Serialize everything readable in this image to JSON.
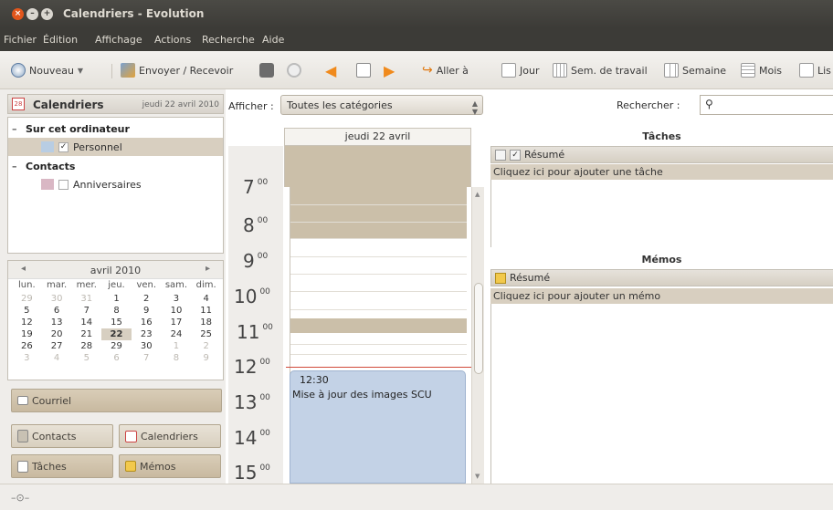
{
  "window": {
    "title": "Calendriers - Evolution"
  },
  "menubar": [
    "Fichier",
    "Édition",
    "Affichage",
    "Actions",
    "Recherche",
    "Aide"
  ],
  "toolbar": {
    "nouveau": "Nouveau",
    "envoyer": "Envoyer / Recevoir",
    "aller": "Aller à",
    "jour": "Jour",
    "sem_travail": "Sem. de travail",
    "semaine": "Semaine",
    "mois": "Mois",
    "liste": "Lis"
  },
  "sidebar": {
    "header_title": "Calendriers",
    "header_date": "jeudi 22 avril 2010",
    "groups": [
      {
        "label": "Sur cet ordinateur",
        "items": [
          {
            "label": "Personnel",
            "checked": true,
            "color": "#b8cde3"
          }
        ]
      },
      {
        "label": "Contacts",
        "items": [
          {
            "label": "Anniversaires",
            "checked": false,
            "color": "#d9b7c4"
          }
        ]
      }
    ]
  },
  "minical": {
    "prev": "◂",
    "next": "▸",
    "month": "avril 2010",
    "days": [
      "lun.",
      "mar.",
      "mer.",
      "jeu.",
      "ven.",
      "sam.",
      "dim."
    ],
    "weeks": [
      [
        "29",
        "30",
        "31",
        "1",
        "2",
        "3",
        "4"
      ],
      [
        "5",
        "6",
        "7",
        "8",
        "9",
        "10",
        "11"
      ],
      [
        "12",
        "13",
        "14",
        "15",
        "16",
        "17",
        "18"
      ],
      [
        "19",
        "20",
        "21",
        "22",
        "23",
        "24",
        "25"
      ],
      [
        "26",
        "27",
        "28",
        "29",
        "30",
        "1",
        "2"
      ],
      [
        "3",
        "4",
        "5",
        "6",
        "7",
        "8",
        "9"
      ]
    ],
    "today": "22"
  },
  "switcher": {
    "courriel": "Courriel",
    "contacts": "Contacts",
    "calendriers": "Calendriers",
    "taches": "Tâches",
    "memos": "Mémos"
  },
  "dayview": {
    "afficher_label": "Afficher :",
    "category": "Toutes les catégories",
    "day_header": "jeudi 22 avril",
    "hours": [
      {
        "h": "7",
        "m": "00"
      },
      {
        "h": "8",
        "m": "00"
      },
      {
        "h": "9",
        "m": "00"
      },
      {
        "h": "10",
        "m": "00"
      },
      {
        "h": "11",
        "m": "00"
      },
      {
        "h": "12",
        "m": "00"
      },
      {
        "h": "13",
        "m": "00"
      },
      {
        "h": "14",
        "m": "00"
      },
      {
        "h": "15",
        "m": "00"
      }
    ],
    "event": {
      "time": "12:30",
      "title": "Mise à jour des images SCU"
    }
  },
  "search": {
    "label": "Rechercher :",
    "value": ""
  },
  "tasks": {
    "title": "Tâches",
    "column": "Résumé",
    "add_hint": "Cliquez ici pour ajouter une tâche"
  },
  "memos": {
    "title": "Mémos",
    "column": "Résumé",
    "add_hint": "Cliquez ici pour ajouter un mémo"
  },
  "colors": {
    "accent": "#cbbfa9",
    "event": "#c3d2e6",
    "close": "#e2561c",
    "menubar": "#3c3b37"
  }
}
